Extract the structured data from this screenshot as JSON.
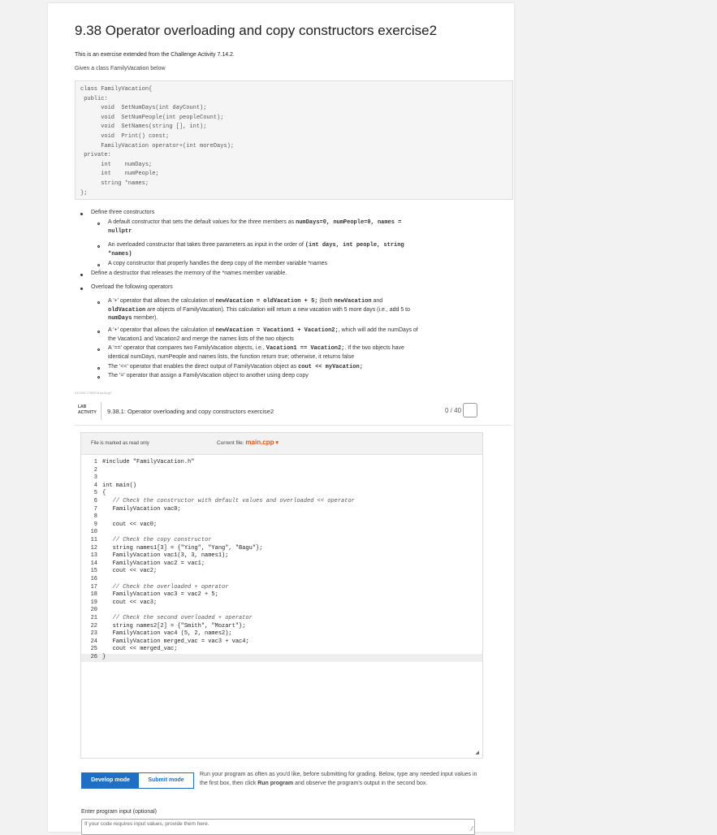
{
  "header": {
    "title": "9.38 Operator overloading and copy constructors exercise2",
    "intro_line1": "This is an exercise extended from the Challenge Activity 7.14.2.",
    "intro_line2": "Given a class FamilyVacation below"
  },
  "class_code": [
    "class FamilyVacation{",
    " public:",
    "      void  SetNumDays(int dayCount);",
    "      void  SetNumPeople(int peopleCount);",
    "      void  SetNames(string [], int);",
    "      void  Print() const;",
    "      FamilyVacation operator+(int moreDays);",
    " private:",
    "      int    numDays;",
    "      int    numPeople;",
    "      string *names;",
    "};"
  ],
  "instructions": {
    "define_constructors": "Define three constructors",
    "ctor_default_a": "A default constructor that sets the default values for the three members as ",
    "ctor_default_code": "numDays=0, numPeople=0, names =",
    "ctor_default_code2": "nullptr",
    "ctor_overloaded_a": "An overloaded constructor that takes three parameters as input in the order of ",
    "ctor_overloaded_code": "(int days, int people, string",
    "ctor_overloaded_code2": "*names)",
    "ctor_copy": "A copy constructor that properly handles the deep copy of the member variable *names",
    "define_destructor": "Define a destructor that releases the memory of the *names member variable.",
    "overload_ops": "Overload the following operators",
    "op_plus_int_a": "A '+' operator that allows the calculation of ",
    "op_plus_int_code": "newVacation = oldVacation + 5;",
    "op_plus_int_b": " (both ",
    "op_plus_int_code2": "newVacation",
    "op_plus_int_c": " and",
    "op_plus_int_code3": "oldVacation",
    "op_plus_int_d": " are objects of FamilyVacation). This calculation will return a new vacation with 5 more days (i.e., add 5 to",
    "op_plus_int_code4": "numDays",
    "op_plus_int_e": " member).",
    "op_plus_vac_a": "A '+' operator that allows the calculation of ",
    "op_plus_vac_code": "newVacation = Vacation1 + Vacation2;",
    "op_plus_vac_b": ", which will add the numDays of",
    "op_plus_vac_c": "the Vacation1 and Vacation2 and merge the names lists of the two objects",
    "op_eq_a": "A '==' operator that compares two FamilyVacation objects, i.e., ",
    "op_eq_code": "Vacation1 == Vacation2;",
    "op_eq_b": ". If the two objects have",
    "op_eq_c": "identical numDays, numPeople and names lists, the function return true; otherwise, it returns false",
    "op_out_a": "The '<<' operator that enables the direct output of FamilyVacation object as ",
    "op_out_code": "cout << myVacation;",
    "op_assign": "The '=' operator that assign a FamilyVacation object to another using deep copy"
  },
  "tiny_label": "410336.2780976.qx3zqy7",
  "lab": {
    "badge_line1": "LAB",
    "badge_line2": "ACTIVITY",
    "title": "9.38.1: Operator overloading and copy constructors exercise2",
    "score": "0 / 40"
  },
  "editor": {
    "read_only": "File is marked as read only",
    "current_file_label": "Current file: ",
    "current_file": "main.cpp",
    "dropdown_icon": "▾"
  },
  "code_lines": [
    {
      "n": "1",
      "t": "#include \"FamilyVacation.h\""
    },
    {
      "n": "2",
      "t": ""
    },
    {
      "n": "3",
      "t": ""
    },
    {
      "n": "4",
      "t": "int main()"
    },
    {
      "n": "5",
      "t": "{"
    },
    {
      "n": "6",
      "t": "   // Check the constructor with default values and overloaded << operator"
    },
    {
      "n": "7",
      "t": "   FamilyVacation vac0;"
    },
    {
      "n": "8",
      "t": ""
    },
    {
      "n": "9",
      "t": "   cout << vac0;"
    },
    {
      "n": "10",
      "t": ""
    },
    {
      "n": "11",
      "t": "   // Check the copy constructor"
    },
    {
      "n": "12",
      "t": "   string names1[3] = {\"Ying\", \"Yang\", \"Bagu\"};"
    },
    {
      "n": "13",
      "t": "   FamilyVacation vac1(3, 3, names1);"
    },
    {
      "n": "14",
      "t": "   FamilyVacation vac2 = vac1;"
    },
    {
      "n": "15",
      "t": "   cout << vac2;"
    },
    {
      "n": "16",
      "t": ""
    },
    {
      "n": "17",
      "t": "   // Check the overloaded + operator"
    },
    {
      "n": "18",
      "t": "   FamilyVacation vac3 = vac2 + 5;"
    },
    {
      "n": "19",
      "t": "   cout << vac3;"
    },
    {
      "n": "20",
      "t": ""
    },
    {
      "n": "21",
      "t": "   // Check the second overloaded + operator"
    },
    {
      "n": "22",
      "t": "   string names2[2] = {\"Smith\", \"Mozart\"};"
    },
    {
      "n": "23",
      "t": "   FamilyVacation vac4 (5, 2, names2);"
    },
    {
      "n": "24",
      "t": "   FamilyVacation merged_vac = vac3 + vac4;"
    },
    {
      "n": "25",
      "t": "   cout << merged_vac;"
    },
    {
      "n": "26",
      "t": "}"
    }
  ],
  "modes": {
    "develop": "Develop mode",
    "submit": "Submit mode"
  },
  "run_text_a": "Run your program as often as you'd like, before submitting for grading. Below, type any needed input values in the first box, then click ",
  "run_text_bold": "Run program",
  "run_text_b": " and observe the program's output in the second box.",
  "input": {
    "label": "Enter program input (optional)",
    "placeholder": "If your code requires input values, provide them here."
  },
  "icons": {
    "resize": "resize-handle-icon",
    "dropdown": "chevron-down-icon"
  }
}
